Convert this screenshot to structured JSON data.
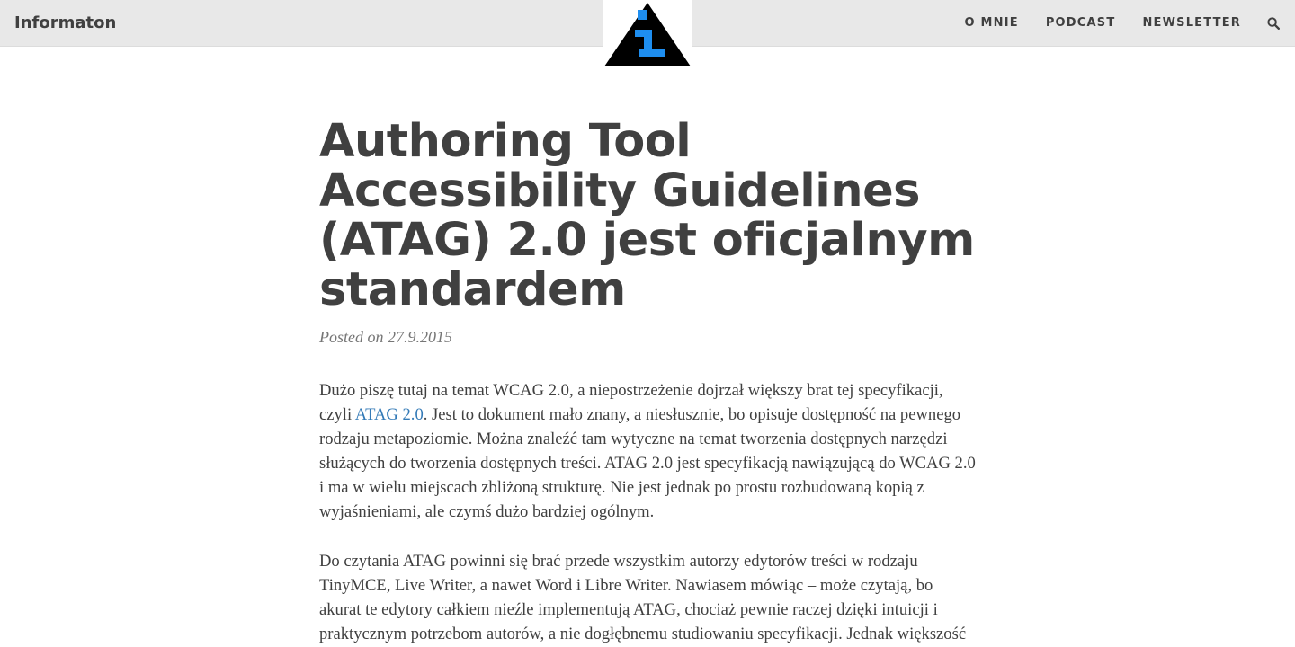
{
  "site": {
    "title": "Informaton",
    "logo_letter": "i"
  },
  "colors": {
    "topbar_bg": "#e8e8e8",
    "text": "#404040",
    "meta": "#767676",
    "link": "#337ab7",
    "logo_accent": "#1e8ef0"
  },
  "nav": {
    "items": [
      "O MNIE",
      "PODCAST",
      "NEWSLETTER"
    ],
    "search_icon": "search-icon"
  },
  "article": {
    "title": "Authoring Tool Accessibility Guidelines (ATAG) 2.0 jest oficjalnym standardem",
    "meta": "Posted on 27.9.2015",
    "p1_before": "Dużo piszę tutaj na temat WCAG 2.0, a niepostrzeżenie dojrzał większy brat tej specyfikacji, czyli ",
    "p1_link": "ATAG 2.0",
    "p1_after": ". Jest to dokument mało znany, a niesłusznie, bo opisuje dostępność na pewnego rodzaju metapoziomie. Można znaleźć tam wytyczne na temat tworzenia dostępnych narzędzi służących do tworzenia dostępnych treści. ATAG 2.0 jest specyfikacją nawiązującą do WCAG 2.0 i ma w wielu miejscach zbliżoną strukturę. Nie jest jednak po prostu rozbudowaną kopią z wyjaśnieniami, ale czymś dużo bardziej ogólnym.",
    "p2": "Do czytania ATAG powinni się brać przede wszystkim autorzy edytorów treści w rodzaju TinyMCE, Live Writer, a nawet Word i Libre Writer. Nawiasem mówiąc – może czytają, bo akurat te edytory całkiem nieźle implementują ATAG, chociaż pewnie raczej dzięki intuicji i praktycznym potrzebom autorów, a nie dogłębnemu studiowaniu specyfikacji. Jednak większość edytorów w ogóle nie wspiera tworzenia dostępnych"
  }
}
